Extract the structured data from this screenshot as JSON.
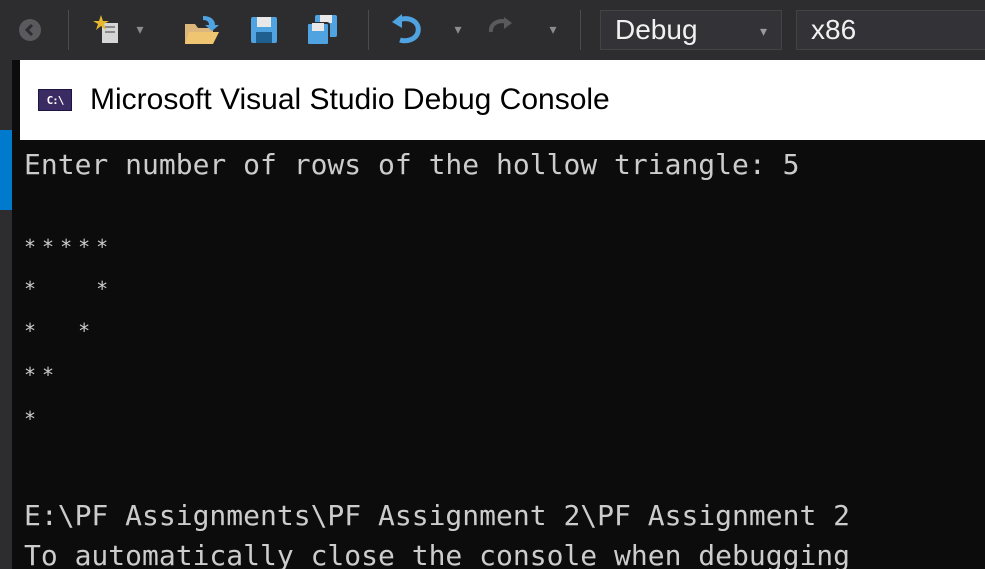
{
  "toolbar": {
    "configuration": "Debug",
    "platform": "x86",
    "icons": [
      "back-icon",
      "new-project-icon",
      "open-file-icon",
      "save-icon",
      "save-all-icon",
      "undo-icon",
      "redo-icon"
    ],
    "dropdown_glyph": "▾"
  },
  "console": {
    "title": "Microsoft Visual Studio Debug Console",
    "icon_text": "C:\\",
    "lines": [
      "Enter number of rows of the hollow triangle: 5",
      "",
      "*****",
      "*   *",
      "*  *",
      "**",
      "*",
      "",
      "",
      "E:\\PF Assignments\\PF Assignment 2\\PF Assignment 2",
      "To automatically close the console when debugging"
    ]
  },
  "colors": {
    "toolbar_bg": "#2d2d30",
    "console_bg": "#0c0c0c",
    "console_text": "#cccccc",
    "accent": "#007acc"
  }
}
